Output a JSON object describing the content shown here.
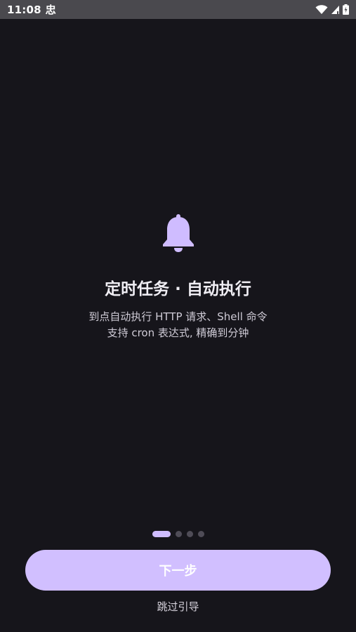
{
  "status_bar": {
    "time": "11:08",
    "app_icon_glyph": "忠",
    "icons": [
      "wifi-icon",
      "signal-icon",
      "battery-icon"
    ]
  },
  "onboarding": {
    "icon": "bell-icon",
    "title": "定时任务 · 自动执行",
    "description_line1": "到点自动执行 HTTP 请求、Shell 命令",
    "description_line2": "支持 cron 表达式, 精确到分钟",
    "page_indicator": {
      "total": 4,
      "current": 1
    },
    "next_label": "下一步",
    "skip_label": "跳过引导"
  },
  "colors": {
    "background": "#16151b",
    "status_bar": "#4a494e",
    "accent": "#cfbcff",
    "button": "#d1bfff"
  }
}
